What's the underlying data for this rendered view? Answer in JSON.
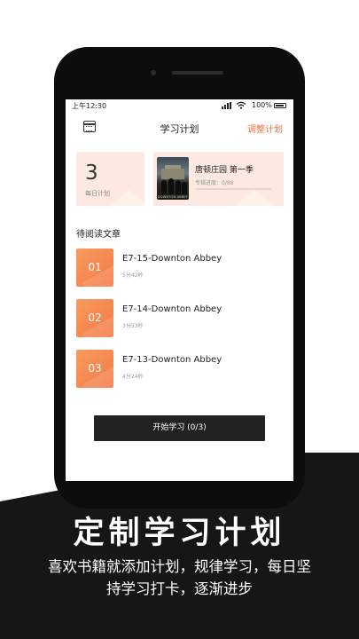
{
  "status_bar": {
    "time": "上午12:30",
    "battery": "100%"
  },
  "nav": {
    "title": "学习计划",
    "action": "调整计划",
    "calendar_icon": "calendar-icon"
  },
  "daily_plan": {
    "count": "3",
    "label": "每日计划"
  },
  "course": {
    "title": "唐顿庄园 第一季",
    "progress_text": "专辑进度：0/88",
    "progress_fraction": 0.0,
    "cover_text": "DOWNTON ABBEY"
  },
  "section": {
    "title": "待阅读文章"
  },
  "articles": [
    {
      "index": "01",
      "title": "E7-15-Downton Abbey",
      "duration": "5分42秒"
    },
    {
      "index": "02",
      "title": "E7-14-Downton Abbey",
      "duration": "3分53秒"
    },
    {
      "index": "03",
      "title": "E7-13-Downton Abbey",
      "duration": "4分24秒"
    }
  ],
  "start_button": {
    "label": "开始学习 (0/3)"
  },
  "promo": {
    "headline": "定制学习计划",
    "subline_1": "喜欢书籍就添加计划，规律学习，每日坚",
    "subline_2": "持学习打卡，逐渐进步"
  },
  "colors": {
    "accent": "#f06e3c",
    "card_bg": "#fde9e1",
    "badge": "#f47a47",
    "dark": "#161616"
  }
}
